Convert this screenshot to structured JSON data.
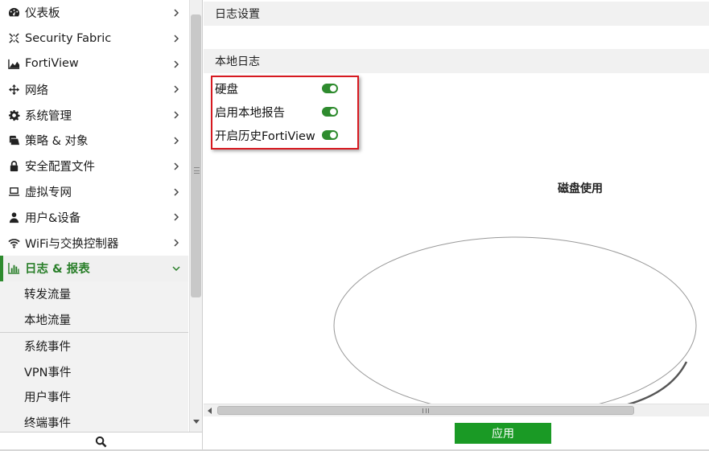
{
  "sidebar": {
    "items": [
      {
        "label": "仪表板",
        "icon": "dashboard-icon"
      },
      {
        "label": "Security Fabric",
        "icon": "security-fabric-icon"
      },
      {
        "label": "FortiView",
        "icon": "area-chart-icon"
      },
      {
        "label": "网络",
        "icon": "network-arrows-icon"
      },
      {
        "label": "系统管理",
        "icon": "gear-icon"
      },
      {
        "label": "策略 & 对象",
        "icon": "policy-icon"
      },
      {
        "label": "安全配置文件",
        "icon": "lock-icon"
      },
      {
        "label": "虚拟专网",
        "icon": "laptop-icon"
      },
      {
        "label": "用户&设备",
        "icon": "user-icon"
      },
      {
        "label": "WiFi与交换控制器",
        "icon": "wifi-icon"
      }
    ],
    "active": {
      "label": "日志 & 报表",
      "icon": "bar-chart-icon"
    },
    "subitems": [
      "转发流量",
      "本地流量",
      "系统事件",
      "VPN事件",
      "用户事件",
      "终端事件"
    ]
  },
  "main": {
    "log_settings_title": "日志设置",
    "local_log_title": "本地日志",
    "toggles": [
      {
        "label": "硬盘",
        "on": true
      },
      {
        "label": "启用本地报告",
        "on": true
      },
      {
        "label": "开启历史FortiView",
        "on": true
      }
    ],
    "disk_usage_title": "磁盘使用",
    "apply_label": "应用"
  },
  "colors": {
    "accent_green": "#2e8b2e",
    "apply_green": "#1a9a25",
    "highlight_red": "#d71920"
  }
}
